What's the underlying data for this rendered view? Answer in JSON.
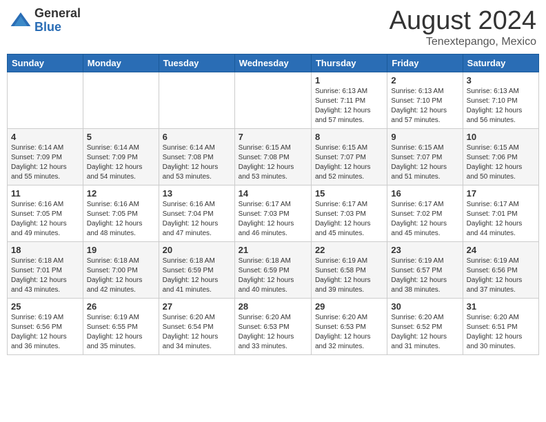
{
  "logo": {
    "general": "General",
    "blue": "Blue"
  },
  "title": "August 2024",
  "location": "Tenextepango, Mexico",
  "days_of_week": [
    "Sunday",
    "Monday",
    "Tuesday",
    "Wednesday",
    "Thursday",
    "Friday",
    "Saturday"
  ],
  "weeks": [
    [
      {
        "day": "",
        "info": ""
      },
      {
        "day": "",
        "info": ""
      },
      {
        "day": "",
        "info": ""
      },
      {
        "day": "",
        "info": ""
      },
      {
        "day": "1",
        "info": "Sunrise: 6:13 AM\nSunset: 7:11 PM\nDaylight: 12 hours\nand 57 minutes."
      },
      {
        "day": "2",
        "info": "Sunrise: 6:13 AM\nSunset: 7:10 PM\nDaylight: 12 hours\nand 57 minutes."
      },
      {
        "day": "3",
        "info": "Sunrise: 6:13 AM\nSunset: 7:10 PM\nDaylight: 12 hours\nand 56 minutes."
      }
    ],
    [
      {
        "day": "4",
        "info": "Sunrise: 6:14 AM\nSunset: 7:09 PM\nDaylight: 12 hours\nand 55 minutes."
      },
      {
        "day": "5",
        "info": "Sunrise: 6:14 AM\nSunset: 7:09 PM\nDaylight: 12 hours\nand 54 minutes."
      },
      {
        "day": "6",
        "info": "Sunrise: 6:14 AM\nSunset: 7:08 PM\nDaylight: 12 hours\nand 53 minutes."
      },
      {
        "day": "7",
        "info": "Sunrise: 6:15 AM\nSunset: 7:08 PM\nDaylight: 12 hours\nand 53 minutes."
      },
      {
        "day": "8",
        "info": "Sunrise: 6:15 AM\nSunset: 7:07 PM\nDaylight: 12 hours\nand 52 minutes."
      },
      {
        "day": "9",
        "info": "Sunrise: 6:15 AM\nSunset: 7:07 PM\nDaylight: 12 hours\nand 51 minutes."
      },
      {
        "day": "10",
        "info": "Sunrise: 6:15 AM\nSunset: 7:06 PM\nDaylight: 12 hours\nand 50 minutes."
      }
    ],
    [
      {
        "day": "11",
        "info": "Sunrise: 6:16 AM\nSunset: 7:05 PM\nDaylight: 12 hours\nand 49 minutes."
      },
      {
        "day": "12",
        "info": "Sunrise: 6:16 AM\nSunset: 7:05 PM\nDaylight: 12 hours\nand 48 minutes."
      },
      {
        "day": "13",
        "info": "Sunrise: 6:16 AM\nSunset: 7:04 PM\nDaylight: 12 hours\nand 47 minutes."
      },
      {
        "day": "14",
        "info": "Sunrise: 6:17 AM\nSunset: 7:03 PM\nDaylight: 12 hours\nand 46 minutes."
      },
      {
        "day": "15",
        "info": "Sunrise: 6:17 AM\nSunset: 7:03 PM\nDaylight: 12 hours\nand 45 minutes."
      },
      {
        "day": "16",
        "info": "Sunrise: 6:17 AM\nSunset: 7:02 PM\nDaylight: 12 hours\nand 45 minutes."
      },
      {
        "day": "17",
        "info": "Sunrise: 6:17 AM\nSunset: 7:01 PM\nDaylight: 12 hours\nand 44 minutes."
      }
    ],
    [
      {
        "day": "18",
        "info": "Sunrise: 6:18 AM\nSunset: 7:01 PM\nDaylight: 12 hours\nand 43 minutes."
      },
      {
        "day": "19",
        "info": "Sunrise: 6:18 AM\nSunset: 7:00 PM\nDaylight: 12 hours\nand 42 minutes."
      },
      {
        "day": "20",
        "info": "Sunrise: 6:18 AM\nSunset: 6:59 PM\nDaylight: 12 hours\nand 41 minutes."
      },
      {
        "day": "21",
        "info": "Sunrise: 6:18 AM\nSunset: 6:59 PM\nDaylight: 12 hours\nand 40 minutes."
      },
      {
        "day": "22",
        "info": "Sunrise: 6:19 AM\nSunset: 6:58 PM\nDaylight: 12 hours\nand 39 minutes."
      },
      {
        "day": "23",
        "info": "Sunrise: 6:19 AM\nSunset: 6:57 PM\nDaylight: 12 hours\nand 38 minutes."
      },
      {
        "day": "24",
        "info": "Sunrise: 6:19 AM\nSunset: 6:56 PM\nDaylight: 12 hours\nand 37 minutes."
      }
    ],
    [
      {
        "day": "25",
        "info": "Sunrise: 6:19 AM\nSunset: 6:56 PM\nDaylight: 12 hours\nand 36 minutes."
      },
      {
        "day": "26",
        "info": "Sunrise: 6:19 AM\nSunset: 6:55 PM\nDaylight: 12 hours\nand 35 minutes."
      },
      {
        "day": "27",
        "info": "Sunrise: 6:20 AM\nSunset: 6:54 PM\nDaylight: 12 hours\nand 34 minutes."
      },
      {
        "day": "28",
        "info": "Sunrise: 6:20 AM\nSunset: 6:53 PM\nDaylight: 12 hours\nand 33 minutes."
      },
      {
        "day": "29",
        "info": "Sunrise: 6:20 AM\nSunset: 6:53 PM\nDaylight: 12 hours\nand 32 minutes."
      },
      {
        "day": "30",
        "info": "Sunrise: 6:20 AM\nSunset: 6:52 PM\nDaylight: 12 hours\nand 31 minutes."
      },
      {
        "day": "31",
        "info": "Sunrise: 6:20 AM\nSunset: 6:51 PM\nDaylight: 12 hours\nand 30 minutes."
      }
    ]
  ]
}
